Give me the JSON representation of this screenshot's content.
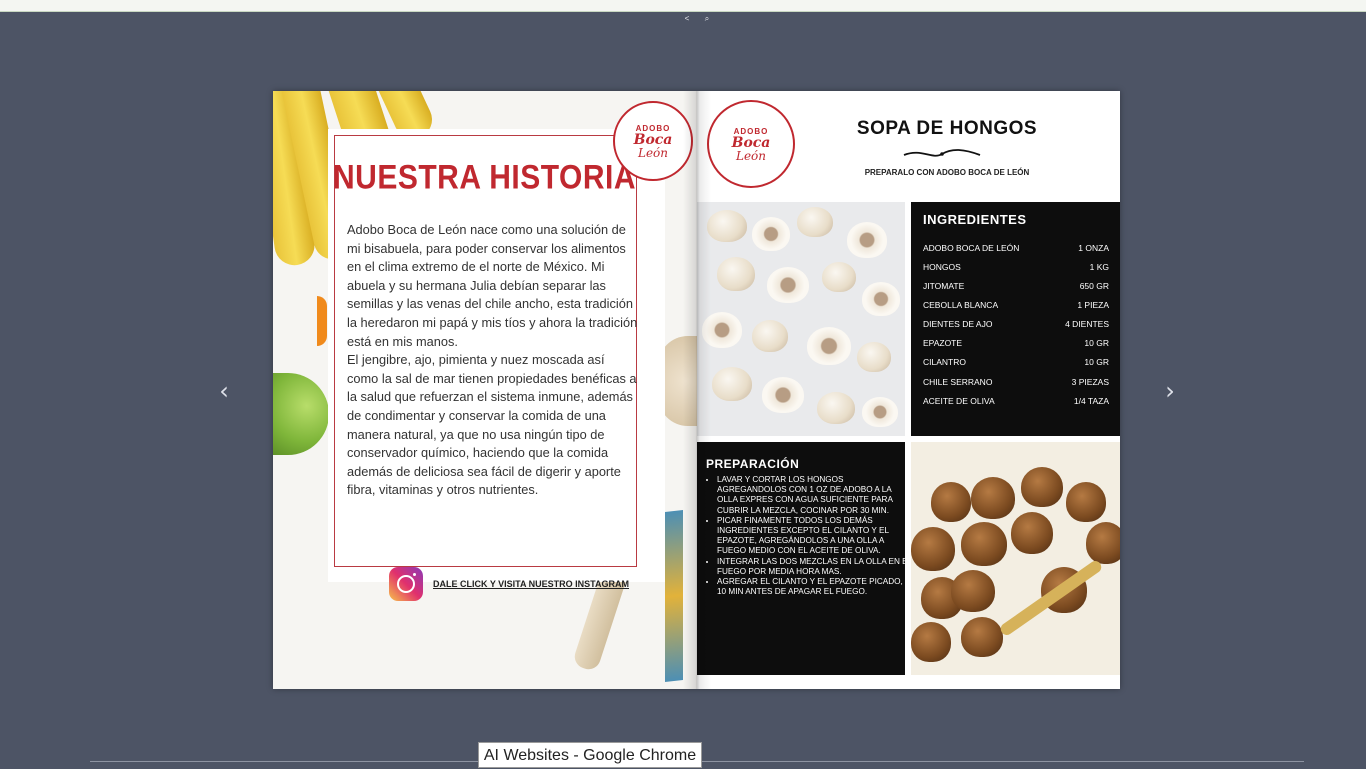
{
  "viewer": {
    "share_icon": "share-icon",
    "zoom_icon": "zoom-icon",
    "prev_arrow": "‹",
    "next_arrow": "›"
  },
  "left_page": {
    "seal": {
      "top": "ADOBO",
      "line1": "Boca",
      "line2": "León"
    },
    "title": "NUESTRA HISTORIA",
    "paragraphs": [
      "Adobo Boca de León nace como una solución de mi bisabuela, para poder conservar los alimentos en el clima extremo de el norte de México. Mi abuela y su hermana Julia debían separar las semillas y las venas del chile ancho, esta tradición la heredaron mi papá y mis tíos y ahora la tradición está en  mis manos.",
      "El jengibre, ajo, pimienta y nuez moscada así como la sal de mar tienen propiedades benéficas a la salud que refuerzan el sistema inmune, además de condimentar y conservar la comida de una manera natural, ya que no usa ningún tipo de conservador químico, haciendo que la comida además de  deliciosa sea fácil de digerir y aporte fibra, vitaminas y otros nutrientes."
    ],
    "instagram_link": "DALE CLICK Y VISITA NUESTRO INSTAGRAM"
  },
  "right_page": {
    "seal": {
      "top": "ADOBO",
      "line1": "Boca",
      "line2": "León"
    },
    "title": "SOPA DE HONGOS",
    "subtitle": "PREPARALO CON ADOBO BOCA DE LEÓN",
    "ingredients_title": "INGREDIENTES",
    "ingredients": [
      {
        "name": "ADOBO BOCA DE LEÓN",
        "qty": "1 ONZA"
      },
      {
        "name": "HONGOS",
        "qty": "1 KG"
      },
      {
        "name": "JITOMATE",
        "qty": "650 GR"
      },
      {
        "name": "CEBOLLA BLANCA",
        "qty": "1 PIEZA"
      },
      {
        "name": "DIENTES DE AJO",
        "qty": "4 DIENTES"
      },
      {
        "name": "EPAZOTE",
        "qty": "10 GR"
      },
      {
        "name": "CILANTRO",
        "qty": "10 GR"
      },
      {
        "name": "CHILE SERRANO",
        "qty": "3 PIEZAS"
      },
      {
        "name": "ACEITE DE OLIVA",
        "qty": "1/4 TAZA"
      }
    ],
    "preparation_title": "PREPARACIÓN",
    "steps": [
      "LAVAR Y CORTAR LOS HONGOS AGREGANDOLOS CON  1 OZ DE ADOBO A LA OLLA EXPRES  CON AGUA SUFICIENTE PARA CUBRIR LA MEZCLA, COCINAR POR 30 MIN.",
      "PICAR FINAMENTE TODOS LOS DEMÁS INGREDIENTES EXCEPTO EL CILANTO Y EL EPAZOTE, AGREGÁNDOLOS A UNA OLLA  A FUEGO MEDIO CON EL ACEITE DE OLIVA.",
      "INTEGRAR LAS DOS MEZCLAS EN LA OLLA EN EL FUEGO POR MEDIA HORA MAS.",
      "AGREGAR EL CILANTO Y EL EPAZOTE PICADO,  10 MIN ANTES DE APAGAR EL FUEGO."
    ]
  },
  "tooltip": {
    "text": "AI Websites - Google Chrome"
  }
}
